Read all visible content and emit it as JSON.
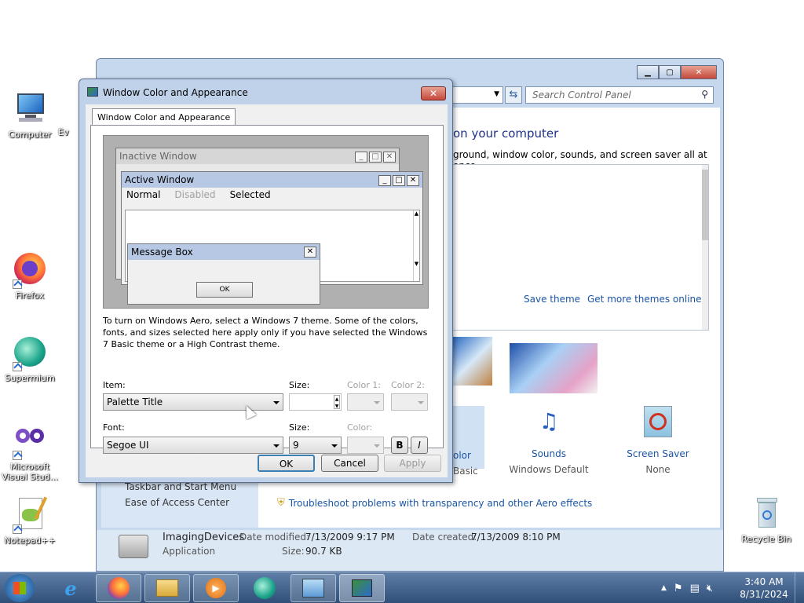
{
  "desktop": {
    "icons": [
      {
        "label": "Computer"
      },
      {
        "label": "Ev"
      },
      {
        "label": "Firefox"
      },
      {
        "label": "Supermium"
      },
      {
        "label": "Microsoft Visual Stud..."
      },
      {
        "label": "Notepad++"
      },
      {
        "label": "Recycle Bin"
      }
    ]
  },
  "control_panel": {
    "search_placeholder": "Search Control Panel",
    "heading_fragment": "on your computer",
    "desc_fragment": "ground, window color, sounds, and screen saver all at once.",
    "save_theme": "Save theme",
    "get_more_themes": "Get more themes online",
    "color_label_fragment": "olor",
    "basic_fragment": "Basic",
    "sounds_label": "Sounds",
    "sounds_value": "Windows Default",
    "screensaver_label": "Screen Saver",
    "screensaver_value": "None",
    "side_item_1": "Taskbar and Start Menu",
    "side_item_2": "Ease of Access Center",
    "troubleshoot": "Troubleshoot problems with transparency and other Aero effects",
    "details": {
      "name": "ImagingDevices",
      "type": "Application",
      "modified_label": "Date modified:",
      "modified_value": "7/13/2009 9:17 PM",
      "created_label": "Date created:",
      "created_value": "7/13/2009 8:10 PM",
      "size_label": "Size:",
      "size_value": "90.7 KB"
    }
  },
  "dialog": {
    "title": "Window Color and Appearance",
    "tab_label": "Window Color and Appearance",
    "preview": {
      "inactive_title": "Inactive Window",
      "active_title": "Active Window",
      "menu_normal": "Normal",
      "menu_disabled": "Disabled",
      "menu_selected": "Selected",
      "msgbox_title": "Message Box",
      "msgbox_ok": "OK"
    },
    "info_text": "To turn on Windows Aero, select a Windows 7 theme.  Some of the colors, fonts, and sizes selected here apply only if you have selected the Windows 7 Basic theme or a High Contrast theme.",
    "item_label": "Item:",
    "item_value": "Palette Title",
    "size_label": "Size:",
    "color1_label": "Color 1:",
    "color2_label": "Color 2:",
    "font_label": "Font:",
    "font_value": "Segoe UI",
    "font_size_label": "Size:",
    "font_size_value": "9",
    "font_color_label": "Color:",
    "bold_label": "B",
    "italic_label": "I",
    "ok": "OK",
    "cancel": "Cancel",
    "apply": "Apply"
  },
  "taskbar": {
    "time": "3:40 AM",
    "date": "8/31/2024"
  }
}
